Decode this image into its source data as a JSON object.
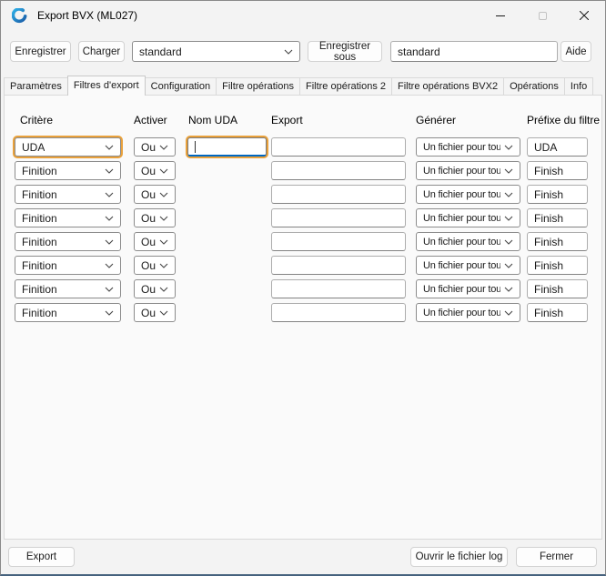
{
  "window": {
    "title": "Export BVX (ML027)"
  },
  "toolbar": {
    "save_label": "Enregistrer",
    "load_label": "Charger",
    "preset_combo_value": "standard",
    "save_as_label": "Enregistrer sous",
    "preset_name_value": "standard",
    "help_label": "Aide"
  },
  "tabs": [
    {
      "label": "Paramètres",
      "active": false
    },
    {
      "label": "Filtres d'export",
      "active": true
    },
    {
      "label": "Configuration",
      "active": false
    },
    {
      "label": "Filtre opérations",
      "active": false
    },
    {
      "label": "Filtre opérations 2",
      "active": false
    },
    {
      "label": "Filtre opérations BVX2",
      "active": false
    },
    {
      "label": "Opérations",
      "active": false
    },
    {
      "label": "Info",
      "active": false
    }
  ],
  "grid": {
    "headers": [
      "Critère",
      "Activer",
      "Nom UDA",
      "Export",
      "Générer",
      "Préfixe du filtre"
    ],
    "rows": [
      {
        "critere": "UDA",
        "activer": "Oui",
        "nom_uda": "",
        "export": "",
        "generer": "Un fichier pour toute",
        "prefixe": "UDA",
        "focused": true
      },
      {
        "critere": "Finition",
        "activer": "Oui",
        "export": "",
        "generer": "Un fichier pour toute",
        "prefixe": "Finish"
      },
      {
        "critere": "Finition",
        "activer": "Oui",
        "export": "",
        "generer": "Un fichier pour toute",
        "prefixe": "Finish"
      },
      {
        "critere": "Finition",
        "activer": "Oui",
        "export": "",
        "generer": "Un fichier pour toute",
        "prefixe": "Finish"
      },
      {
        "critere": "Finition",
        "activer": "Oui",
        "export": "",
        "generer": "Un fichier pour toute",
        "prefixe": "Finish"
      },
      {
        "critere": "Finition",
        "activer": "Oui",
        "export": "",
        "generer": "Un fichier pour toute",
        "prefixe": "Finish"
      },
      {
        "critere": "Finition",
        "activer": "Oui",
        "export": "",
        "generer": "Un fichier pour toute",
        "prefixe": "Finish"
      },
      {
        "critere": "Finition",
        "activer": "Oui",
        "export": "",
        "generer": "Un fichier pour toute",
        "prefixe": "Finish"
      }
    ]
  },
  "footer": {
    "export_label": "Export",
    "open_log_label": "Ouvrir le fichier log",
    "close_label": "Fermer"
  },
  "colors": {
    "focus_ring": "#E9A13B",
    "accent_blue": "#0067C0"
  }
}
